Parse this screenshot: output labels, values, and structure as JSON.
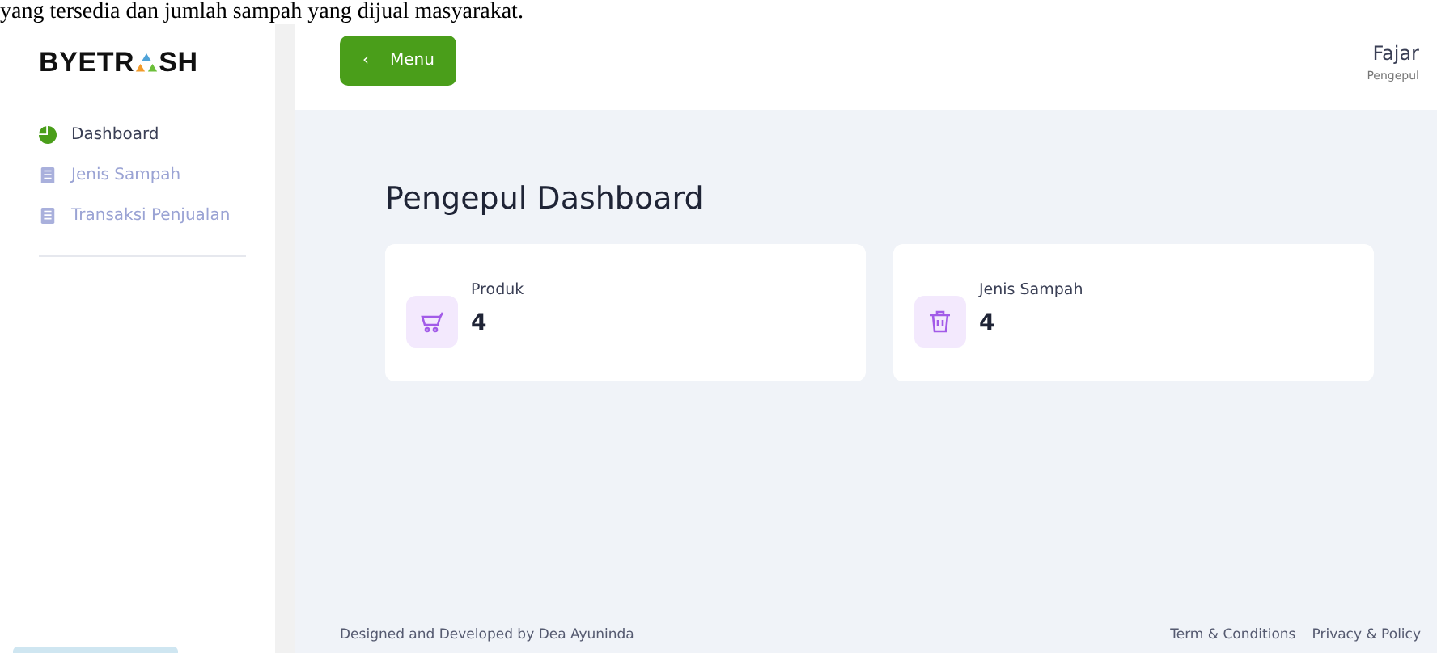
{
  "document_text": "yang tersedia dan jumlah sampah yang dijual masyarakat.",
  "logo": {
    "before": "BYETR",
    "after": "SH"
  },
  "sidebar": {
    "items": [
      {
        "label": "Dashboard",
        "kind": "chart",
        "selected": true
      },
      {
        "label": "Jenis Sampah",
        "kind": "list",
        "selected": false
      },
      {
        "label": "Transaksi Penjualan",
        "kind": "list",
        "selected": false
      }
    ]
  },
  "header": {
    "menu_button": {
      "icon": "‹",
      "label": "Menu"
    },
    "user": {
      "name": "Fajar",
      "role": "Pengepul"
    }
  },
  "title": "Pengepul Dashboard",
  "cards": [
    {
      "label": "Produk",
      "value": "4",
      "kind": "cart"
    },
    {
      "label": "Jenis Sampah",
      "value": "4",
      "kind": "trash"
    }
  ],
  "footer": {
    "credit": "Designed and Developed by Dea Ayuninda",
    "links": [
      "Term & Conditions",
      "Privacy & Policy"
    ]
  }
}
